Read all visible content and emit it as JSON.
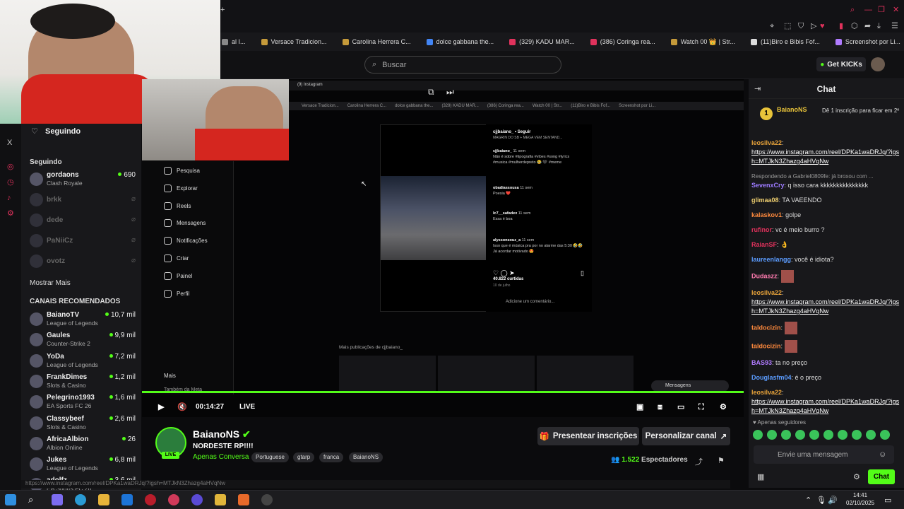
{
  "bookmarks": [
    "al I...",
    "Versace Tradicion...",
    "Carolina Herrera C...",
    "dolce gabbana the...",
    "(329) KADU MAR...",
    "(386) Coringa rea...",
    "Watch 00 👑 | Str...",
    "(11)Biro e Bibis Fof...",
    "Screenshot por Li..."
  ],
  "header": {
    "search_placeholder": "Buscar",
    "get_kicks": "Get KICKs"
  },
  "sidebar": {
    "title": "Seguindo",
    "following_label": "Seguindo",
    "following": [
      {
        "name": "gordaons",
        "game": "Clash Royale",
        "viewers": "690",
        "live": true
      },
      {
        "name": "brkk",
        "game": "",
        "viewers": "",
        "live": false
      },
      {
        "name": "dede",
        "game": "",
        "viewers": "",
        "live": false
      },
      {
        "name": "PaNiiCz",
        "game": "",
        "viewers": "",
        "live": false
      },
      {
        "name": "ovotz",
        "game": "",
        "viewers": "",
        "live": false
      }
    ],
    "show_more": "Mostrar Mais",
    "recommended_label": "CANAIS RECOMENDADOS",
    "recommended": [
      {
        "name": "BaianoTV",
        "game": "League of Legends",
        "viewers": "10,7 mil"
      },
      {
        "name": "Gaules",
        "game": "Counter-Strike 2",
        "viewers": "9,9 mil"
      },
      {
        "name": "YoDa",
        "game": "League of Legends",
        "viewers": "7,2 mil"
      },
      {
        "name": "FrankDimes",
        "game": "Slots & Casino",
        "viewers": "1,2 mil"
      },
      {
        "name": "Pelegrino1993",
        "game": "EA Sports FC 26",
        "viewers": "1,6 mil"
      },
      {
        "name": "Classybeef",
        "game": "Slots & Casino",
        "viewers": "2,6 mil"
      },
      {
        "name": "AfricaAlbion",
        "game": "Albion Online",
        "viewers": "26"
      },
      {
        "name": "Jukes",
        "game": "League of Legends",
        "viewers": "6,8 mil"
      },
      {
        "name": "adolfz",
        "game": "EA Sports FC 26",
        "viewers": "3,6 mil"
      }
    ]
  },
  "inner": {
    "tab_title": "(9) Instagram",
    "bookmarks": [
      "Versace Tradicion...",
      "Carolina Herrera C...",
      "dolce gabbana the...",
      "(329) KADU MAR...",
      "(386) Coringa rea...",
      "Watch 00 | Str...",
      "(11)Biro e Bibis Fof...",
      "Screenshot por Li..."
    ],
    "nav": [
      "Pesquisa",
      "Explorar",
      "Reels",
      "Mensagens",
      "Notificações",
      "Criar",
      "Painel",
      "Perfil"
    ],
    "more": "Mais",
    "meta": "Também da Meta",
    "post_user": "cjjbaiano_ • Seguir",
    "post_sub": "MAGRIN DO SB + MEGA VEM SENTAND...",
    "comments": [
      {
        "user": "cjjbaiano_",
        "time": "11 sem",
        "text": "Não é sobre #tipografia #vibes #song #lyrics #musica #mulherdepreto 😂 🖤 #meme"
      },
      {
        "user": "obadiassousa",
        "time": "11 sem",
        "text": "Poesia ❤️"
      },
      {
        "user": "lc7__safadex",
        "time": "11 sem",
        "text": "Essa é boa"
      },
      {
        "user": "alyssonsouz_a",
        "time": "11 sem",
        "text": "Isso que é música pra por no alarme das 5:30 🤣🤣 Já acordar motivado 😍"
      }
    ],
    "likes": "40.822 curtidas",
    "date": "10 de julho",
    "add_comment": "Adicione um comentário...",
    "more_posts": "Mais publicações de cjjbaiano_",
    "messages": "Mensagens"
  },
  "player": {
    "time": "00:14:27",
    "live": "LIVE",
    "progress": 1.0
  },
  "stream": {
    "name": "BaianoNS",
    "title": "NORDESTE RP!!!!",
    "category": "Apenas Conversa",
    "tags": [
      "Portuguese",
      "gtarp",
      "franca",
      "BaianoNS"
    ],
    "subscribe": "Presentear inscrições",
    "customize": "Personalizar canal",
    "viewers": "1.522",
    "viewers_label": "Espectadores",
    "live_badge": "LIVE"
  },
  "status_url": "https://www.instagram.com/reel/DPKa1waDRJq/?igsh=MTJkN3Zhazg4aHVqNw",
  "chat": {
    "title": "Chat",
    "pinned_user": "BaianoNS",
    "pinned_text": "Dê 1 inscrição para ficar em 2º",
    "messages": [
      {
        "user": "leosilva22",
        "color": "#e8a33a",
        "text": "",
        "link": "https://www.instagram.com/reel/DPKa1waDRJq/?igsh=MTJkN3Zhazg4aHVqNw"
      },
      {
        "user": "SevenxCry",
        "color": "#9d7bff",
        "text": "q isso cara kkkkkkkkkkkkkkk",
        "reply": "Respondendo a Gabriel0809fe: já broxou com ..."
      },
      {
        "user": "glimaa08",
        "color": "#f0d070",
        "text": "TA VAEENDO"
      },
      {
        "user": "kalaskov1",
        "color": "#ff8a3d",
        "text": "golpe"
      },
      {
        "user": "rufinor",
        "color": "#e0325c",
        "text": "vc é meio burro ?"
      },
      {
        "user": "RaianSF",
        "color": "#e0325c",
        "text": "👌"
      },
      {
        "user": "laureenlangg",
        "color": "#5b9cff",
        "text": "você é idiota?"
      },
      {
        "user": "Dudaszz",
        "color": "#ff7bb0",
        "text": ""
      },
      {
        "user": "leosilva22",
        "color": "#e8a33a",
        "text": "",
        "link": "https://www.instagram.com/reel/DPKa1waDRJq/?igsh=MTJkN3Zhazg4aHVqNw"
      },
      {
        "user": "taldocizin",
        "color": "#ff8a3d",
        "text": ""
      },
      {
        "user": "taldocizin",
        "color": "#ff8a3d",
        "text": ""
      },
      {
        "user": "BAS93",
        "color": "#b07bff",
        "text": "ta no preço"
      },
      {
        "user": "Douglasfm04",
        "color": "#5b9cff",
        "text": "é o preço"
      },
      {
        "user": "leosilva22",
        "color": "#e8a33a",
        "text": "",
        "link": "https://www.instagram.com/reel/DPKa1waDRJq/?igsh=MTJkN3Zhazg4aHVqNw"
      }
    ],
    "followers_only": "Apenas seguidores",
    "input_placeholder": "Envie uma mensagem",
    "send": "Chat"
  },
  "taskbar": {
    "time": "14:41",
    "date": "02/10/2025"
  }
}
